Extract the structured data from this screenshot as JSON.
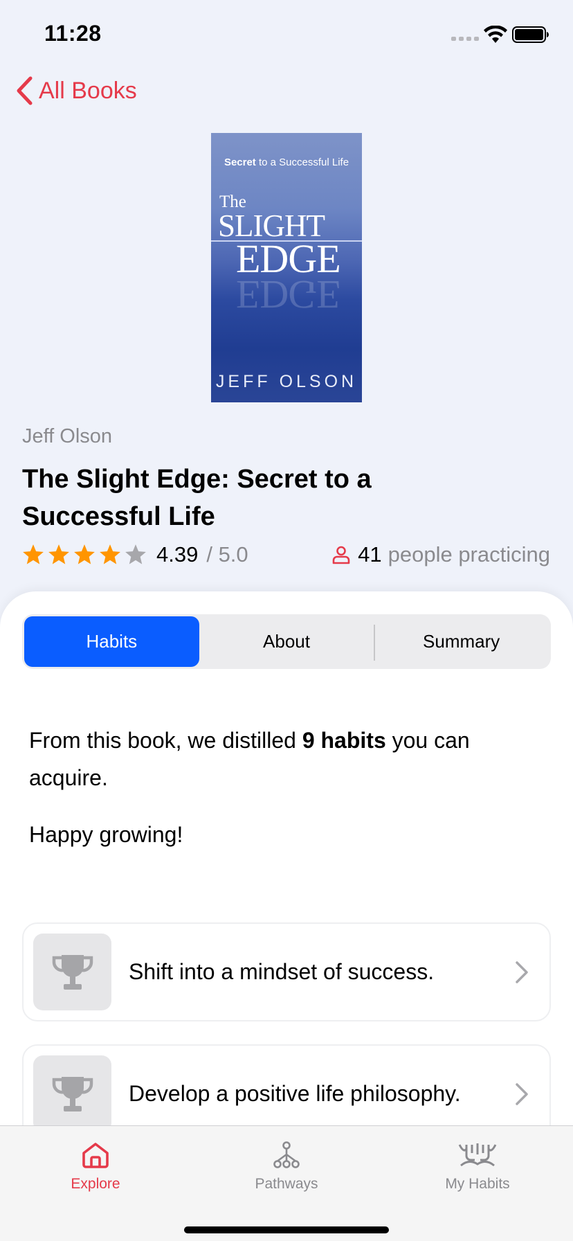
{
  "status_bar": {
    "time": "11:28"
  },
  "nav": {
    "back_label": "All Books"
  },
  "book": {
    "cover": {
      "tagline_bold": "Secret",
      "tagline_rest": " to a Successful Life",
      "title_the": "The",
      "title_slight": "SLIGHT",
      "title_edge": "EDGE",
      "reflection": "EDGE",
      "author": "JEFF OLSON"
    },
    "author": "Jeff Olson",
    "title": "The Slight Edge: Secret to a Successful Life",
    "rating": {
      "value": "4.39",
      "max": "/ 5.0",
      "stars_filled": 4,
      "stars_total": 5
    },
    "practicing": {
      "count": "41",
      "label": "people practicing"
    }
  },
  "tabs": [
    {
      "label": "Habits",
      "active": true
    },
    {
      "label": "About",
      "active": false
    },
    {
      "label": "Summary",
      "active": false
    }
  ],
  "intro": {
    "prefix": "From this book, we distilled ",
    "bold": "9 habits",
    "suffix": " you can acquire.",
    "greeting": "Happy growing!"
  },
  "habits": [
    {
      "label": "Shift into a mindset of success.",
      "icon": "trophy-icon"
    },
    {
      "label": "Develop a positive life philosophy.",
      "icon": "trophy-icon"
    }
  ],
  "tab_bar": [
    {
      "label": "Explore",
      "icon": "home-icon",
      "active": true
    },
    {
      "label": "Pathways",
      "icon": "pathways-icon",
      "active": false
    },
    {
      "label": "My Habits",
      "icon": "habits-icon",
      "active": false
    }
  ],
  "colors": {
    "accent": "#e53a4a",
    "segment_active": "#0a5dff",
    "star": "#ff9500",
    "star_empty": "#a7a7ab"
  }
}
